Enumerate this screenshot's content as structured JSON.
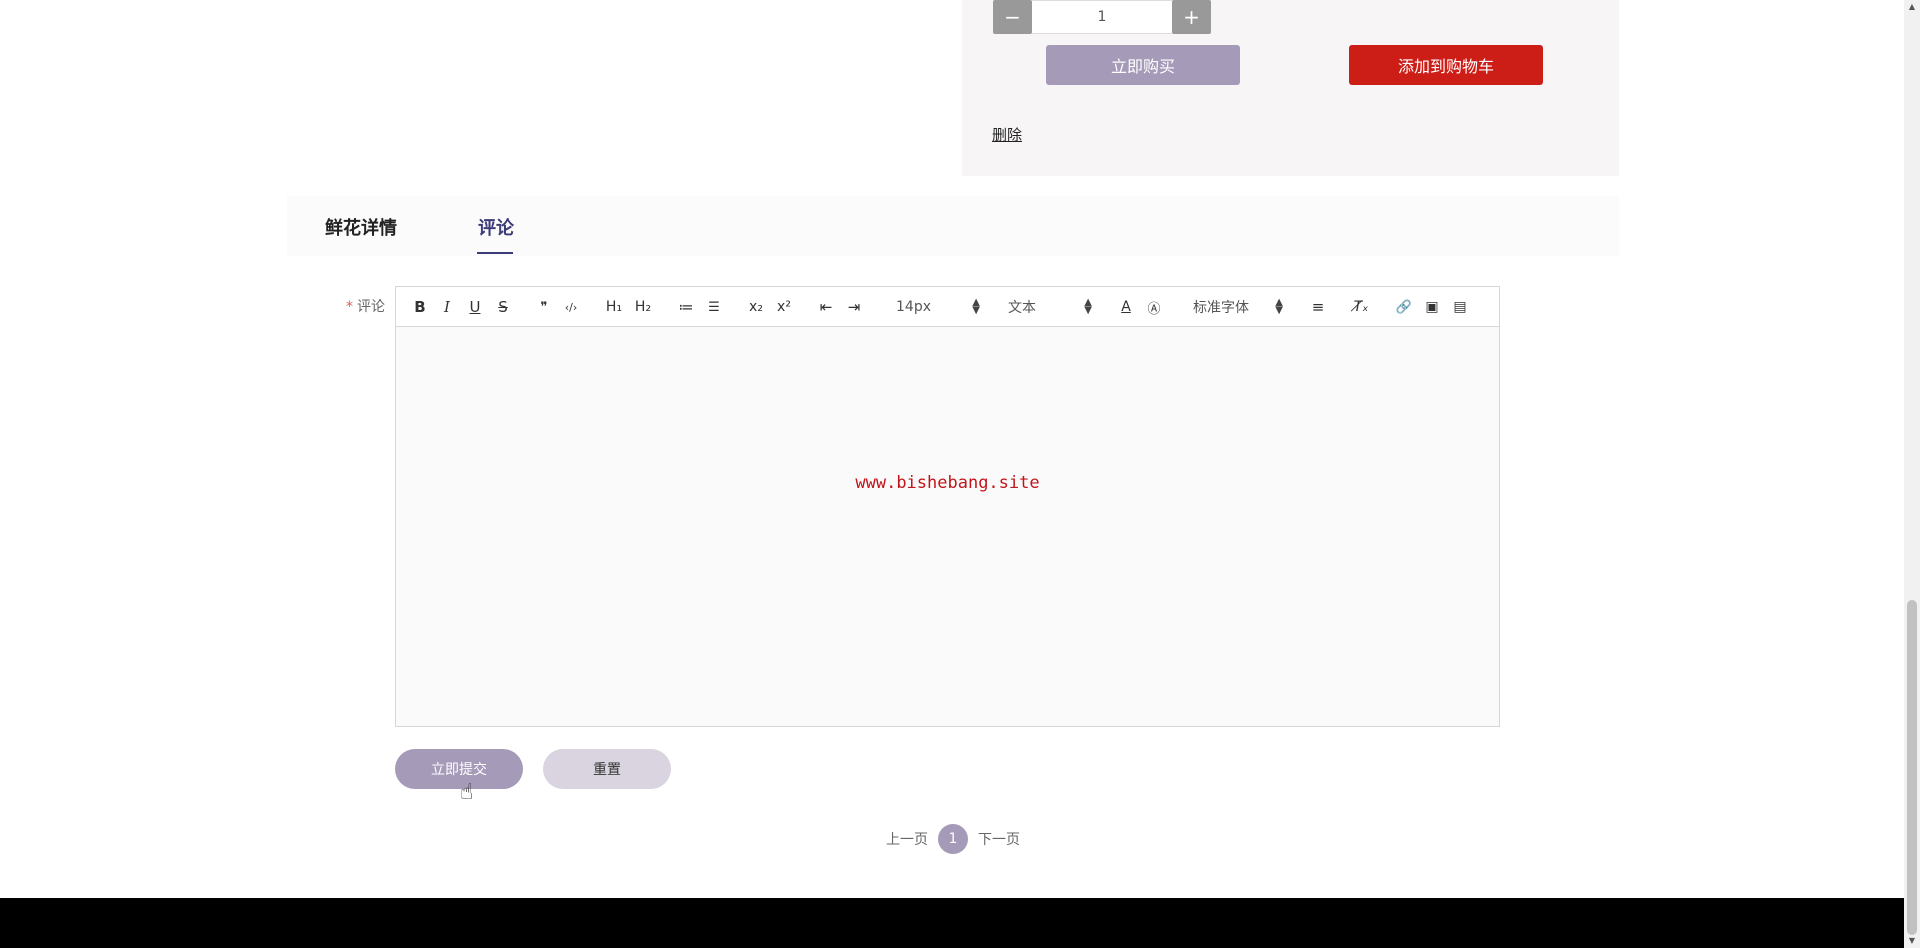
{
  "product": {
    "quantity": "1",
    "qty_minus": "−",
    "qty_plus": "+",
    "buy_now_label": "立即购买",
    "add_to_cart_label": "添加到购物车",
    "delete_label": "删除"
  },
  "tabs": [
    {
      "label": "鲜花详情"
    },
    {
      "label": "评论",
      "active": true
    }
  ],
  "comment_form": {
    "required_mark": "*",
    "label": "评论",
    "editor": {
      "toolbar": {
        "bold": "B",
        "italic": "I",
        "underline": "U",
        "strike": "S",
        "quote": "❞",
        "code": "‹/›",
        "h1": "H₁",
        "h2": "H₂",
        "ordered_list": "≔",
        "bullet_list": "☰",
        "subscript": "x₂",
        "superscript": "x²",
        "outdent": "⇤",
        "indent": "⇥",
        "size_value": "14px",
        "heading_value": "文本",
        "color": "A",
        "background": "Ⓐ",
        "font_value": "标准字体",
        "align": "≡",
        "clean": "T̸ₓ",
        "link": "🔗",
        "image": "▣",
        "video": "▤"
      },
      "watermark": "www.bishebang.site"
    },
    "submit_label": "立即提交",
    "reset_label": "重置"
  },
  "pagination": {
    "prev_label": "上一页",
    "current_page": "1",
    "next_label": "下一页"
  },
  "colors": {
    "primary": "#a59ab8",
    "danger": "#cc1d17",
    "tab_active": "#3d3a78",
    "footer": "#000000"
  }
}
